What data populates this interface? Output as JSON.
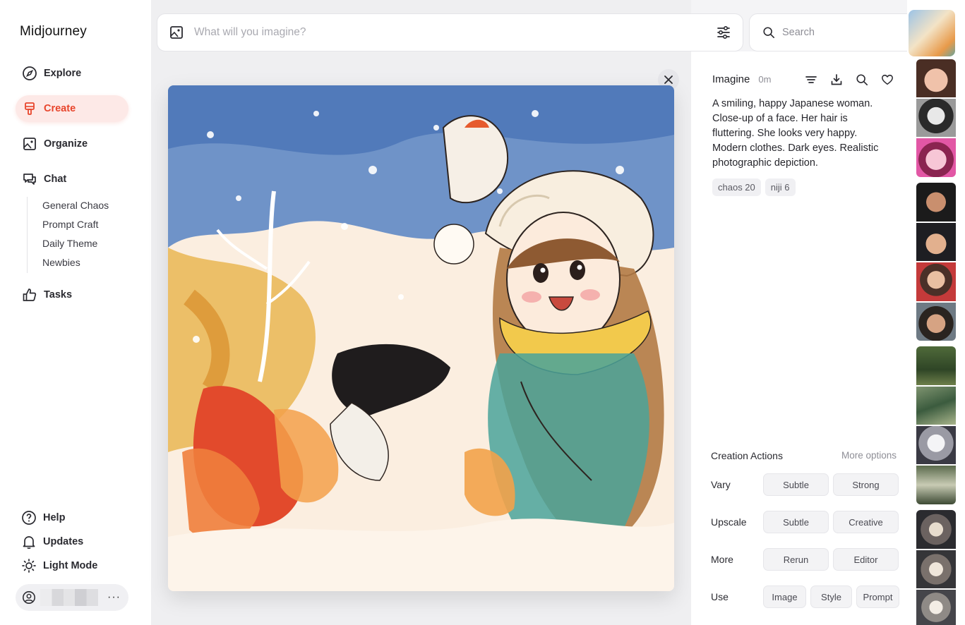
{
  "app": {
    "name": "Midjourney"
  },
  "nav": [
    {
      "label": "Explore",
      "icon": "compass-icon"
    },
    {
      "label": "Create",
      "icon": "brush-icon",
      "active": true
    },
    {
      "label": "Organize",
      "icon": "image-icon"
    },
    {
      "label": "Chat",
      "icon": "chat-icon"
    }
  ],
  "chat_rooms": [
    "General Chaos",
    "Prompt Craft",
    "Daily Theme",
    "Newbies"
  ],
  "tasks": {
    "label": "Tasks",
    "icon": "thumbs-up-icon"
  },
  "bottom_nav": [
    {
      "label": "Help",
      "icon": "help-icon"
    },
    {
      "label": "Updates",
      "icon": "bell-icon"
    },
    {
      "label": "Light Mode",
      "icon": "sun-icon"
    }
  ],
  "user": {
    "more": "···"
  },
  "imagine": {
    "placeholder": "What will you imagine?"
  },
  "search": {
    "placeholder": "Search"
  },
  "details": {
    "title": "Imagine",
    "time": "0m",
    "prompt": "A smiling, happy Japanese woman. Close-up of a face. Her hair is fluttering. She looks very happy. Modern clothes. Dark eyes. Realistic photographic depiction.",
    "tags": [
      "chaos 20",
      "niji 6"
    ]
  },
  "creation_actions": {
    "title": "Creation Actions",
    "more": "More options",
    "rows": [
      {
        "label": "Vary",
        "buttons": [
          "Subtle",
          "Strong"
        ]
      },
      {
        "label": "Upscale",
        "buttons": [
          "Subtle",
          "Creative"
        ]
      },
      {
        "label": "More",
        "buttons": [
          "Rerun",
          "Editor"
        ]
      },
      {
        "label": "Use",
        "buttons": [
          "Image",
          "Style",
          "Prompt"
        ]
      }
    ]
  },
  "colors": {
    "accent": "#e8452c",
    "accent_bg": "#fde9e7"
  }
}
